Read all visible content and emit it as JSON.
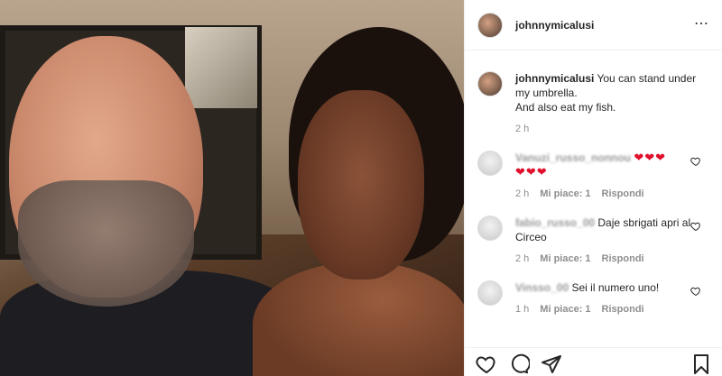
{
  "post": {
    "username": "johnnymicalusi",
    "caption": {
      "username": "johnnymicalusi",
      "line1": "You can stand under my umbrella.",
      "line2": "And also eat my fish.",
      "time": "2 h"
    }
  },
  "comments": [
    {
      "username_obscured": "Vanuzi_russo_nonnou",
      "text": "❤❤❤",
      "text2": "❤❤❤",
      "time": "2 h",
      "likes": "Mi piace: 1",
      "reply": "Rispondi"
    },
    {
      "username_obscured": "fabio_russo_00",
      "text": "Daje sbrigati apri al Circeo",
      "time": "2 h",
      "likes": "Mi piace: 1",
      "reply": "Rispondi"
    },
    {
      "username_obscured": "Vinsso_00",
      "text": "Sei il numero uno!",
      "time": "1 h",
      "likes": "Mi piace: 1",
      "reply": "Rispondi"
    }
  ],
  "icons": {
    "more": "more-options-icon",
    "heart": "heart-icon",
    "comment": "comment-icon",
    "share": "share-icon",
    "save": "bookmark-icon"
  },
  "colors": {
    "heart_red": "#e0102d",
    "meta_gray": "#8e8e8e"
  }
}
